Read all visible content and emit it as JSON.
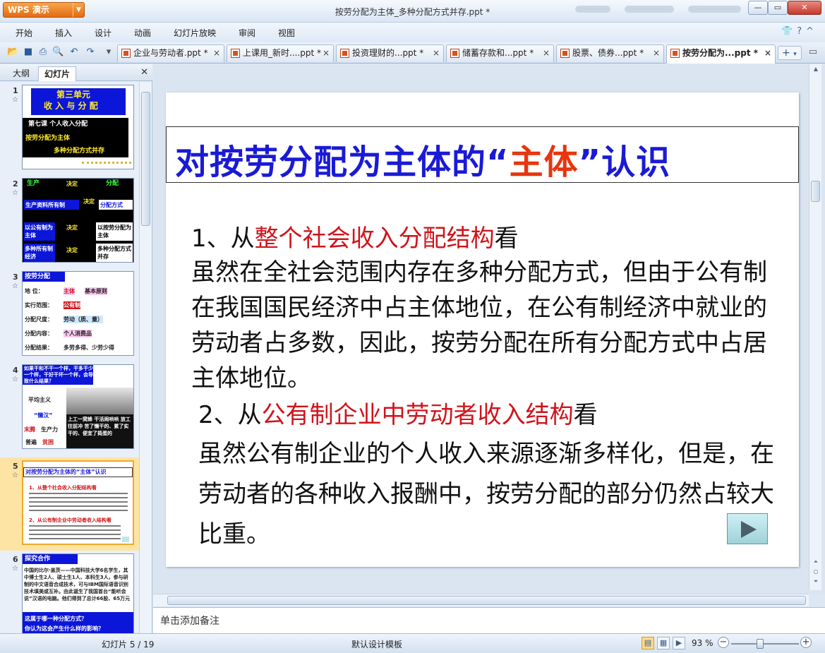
{
  "app": {
    "name": "WPS 演示",
    "window_title": "按劳分配为主体_多种分配方式并存.ppt *"
  },
  "menu": [
    "开始",
    "插入",
    "设计",
    "动画",
    "幻灯片放映",
    "审阅",
    "视图"
  ],
  "doc_tabs": [
    {
      "label": "企业与劳动者.ppt *",
      "active": false
    },
    {
      "label": "上课用_新时....ppt *",
      "active": false
    },
    {
      "label": "投资理财的...ppt *",
      "active": false
    },
    {
      "label": "储蓄存款和...ppt *",
      "active": false
    },
    {
      "label": "股票、债券...ppt *",
      "active": false
    },
    {
      "label": "按劳分配为...ppt *",
      "active": true
    }
  ],
  "left_panel": {
    "tabs": [
      "大纲",
      "幻灯片"
    ],
    "active_tab": "幻灯片",
    "thumbnails": [
      {
        "num": "1",
        "lines": [
          "第三单元",
          "收 入 与 分 配",
          "第七课    个人收入分配",
          "按劳分配为主体",
          "多种分配方式并存"
        ]
      },
      {
        "num": "2",
        "lines": [
          "生产",
          "决定",
          "分配",
          "生产资料所有制",
          "决定",
          "分配方式",
          "以公有制为主体",
          "决定",
          "以按劳分配为主体",
          "多种所有制经济",
          "决定",
          "多种分配方式并存"
        ]
      },
      {
        "num": "3",
        "lines": [
          "按劳分配",
          "地    位：",
          "主体",
          "基本原则",
          "实行范围：",
          "公有制",
          "分配尺度：",
          "劳动（质、量）",
          "分配内容：",
          "个人消费品",
          "分配结果：",
          "多劳多得、少劳少得"
        ]
      },
      {
        "num": "4",
        "lines": [
          "如果干和不干一个样，干多干少一个样，干好干坏一个样，会导致什么结果？",
          "平均主义",
          "“懒汉”",
          "末腾",
          "生产力",
          "普遍",
          "贫困",
          "上工一窝蜂 干活闹哄哄 放工往前冲 苦了懒干的、累了实干的、便宜了捣蛋的"
        ]
      },
      {
        "num": "5",
        "lines": [
          "对按劳分配为主体的“主体”认识",
          "1、从整个社会收入分配结构看",
          "2、从公有制企业中劳动者收入结构看"
        ]
      },
      {
        "num": "6",
        "lines": [
          "探究合作",
          "中国的比尔·盖茨——中国科技大学6名学生，其中博士生2人、硕士生1人、本科生3人，参与研制的中文语音合成技术，可与IBM国际语音识别技术填美或互补。由此诞生了我国首台“能听会说”汉语的电脑。他们得到了总计66股、65万元",
          "这属于哪一种分配方式？",
          "你认为这会产生什么样的影响？"
        ]
      }
    ]
  },
  "slide": {
    "title_pre": "对按劳分配为主体的“",
    "title_highlight": "主体",
    "title_post": "”认识",
    "p1_prefix": "1、从",
    "p1_highlight": "整个社会收入分配结构",
    "p1_suffix": "看",
    "p1_body": "虽然在全社会范围内存在多种分配方式，但由于公有制在我国国民经济中占主体地位，在公有制经济中就业的劳动者占多数，因此，按劳分配在所有分配方式中占居主体地位。",
    "p2_prefix": "2、从",
    "p2_highlight": "公有制企业中劳动者收入结构",
    "p2_suffix": "看",
    "p2_body": "虽然公有制企业的个人收入来源逐渐多样化，但是，在劳动者的各种收入报酬中，按劳分配的部分仍然占较大比重。"
  },
  "notes_placeholder": "单击添加备注",
  "status": {
    "slide_counter": "幻灯片 5 / 19",
    "template": "默认设计模板",
    "zoom": "93 %",
    "zoom_value": 93
  },
  "colors": {
    "title_blue": "#1a1ad6",
    "title_red": "#e8350e",
    "body_red": "#d0141b"
  }
}
